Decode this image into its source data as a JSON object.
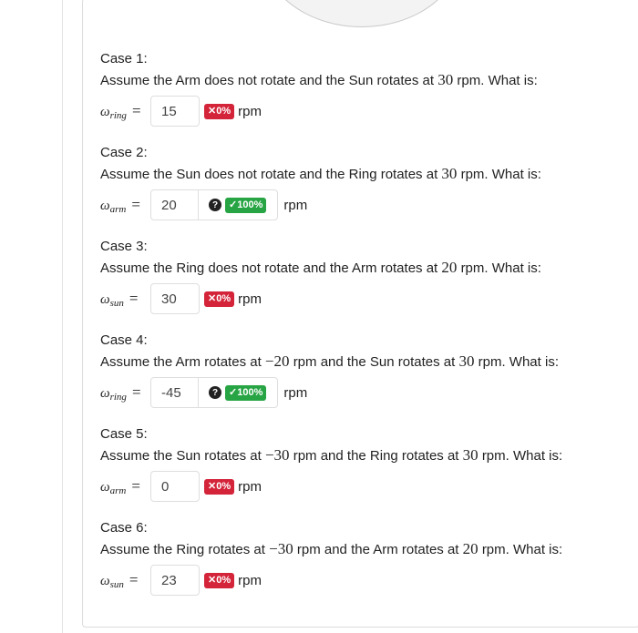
{
  "unit": "rpm",
  "colors": {
    "wrong_badge": "#d4243a",
    "right_badge": "#27a443"
  },
  "cases": [
    {
      "title": "Case 1:",
      "question_pre": "Assume the Arm does not rotate and the Sun rotates at",
      "q_num1": "30",
      "question_mid": "",
      "q_num2": "",
      "question_post": "rpm. What is:",
      "var_main": "ω",
      "var_sub": "ring",
      "answer": "15",
      "badge": "✕0%",
      "status": "wrong"
    },
    {
      "title": "Case 2:",
      "question_pre": "Assume the Sun does not rotate and the Ring rotates at",
      "q_num1": "30",
      "question_mid": "",
      "q_num2": "",
      "question_post": "rpm. What is:",
      "var_main": "ω",
      "var_sub": "arm",
      "answer": "20",
      "help": "?",
      "badge": "✓100%",
      "status": "correct"
    },
    {
      "title": "Case 3:",
      "question_pre": "Assume the Ring does not rotate and the Arm rotates at",
      "q_num1": "20",
      "question_mid": "",
      "q_num2": "",
      "question_post": "rpm. What is:",
      "var_main": "ω",
      "var_sub": "sun",
      "answer": "30",
      "badge": "✕0%",
      "status": "wrong"
    },
    {
      "title": "Case 4:",
      "question_pre": "Assume the Arm rotates at",
      "q_num1": "−20",
      "question_mid": "rpm and the Sun rotates at",
      "q_num2": "30",
      "question_post": "rpm. What is:",
      "var_main": "ω",
      "var_sub": "ring",
      "answer": "-45",
      "help": "?",
      "badge": "✓100%",
      "status": "correct"
    },
    {
      "title": "Case 5:",
      "question_pre": "Assume the Sun rotates at",
      "q_num1": "−30",
      "question_mid": "rpm and the Ring rotates at",
      "q_num2": "30",
      "question_post": "rpm. What is:",
      "var_main": "ω",
      "var_sub": "arm",
      "answer": "0",
      "badge": "✕0%",
      "status": "wrong"
    },
    {
      "title": "Case 6:",
      "question_pre": "Assume the Ring rotates at",
      "q_num1": "−30",
      "question_mid": "rpm and the Arm rotates at",
      "q_num2": "20",
      "question_post": "rpm. What is:",
      "var_main": "ω",
      "var_sub": "sun",
      "answer": "23",
      "badge": "✕0%",
      "status": "wrong"
    }
  ]
}
